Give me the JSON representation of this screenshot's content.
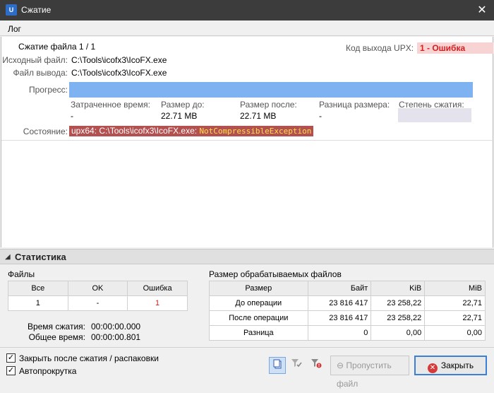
{
  "window": {
    "title": "Сжатие",
    "logo_text": "U",
    "close_glyph": "✕"
  },
  "log": {
    "tab_label": "Лог",
    "heading": "Сжатие файла 1 / 1",
    "exit_code_label": "Код выхода UPX:",
    "exit_code_value": "1 - Ошибка",
    "source_label": "Исходный файл:",
    "source_value": "C:\\Tools\\icofx3\\IcoFX.exe",
    "output_label": "Файл вывода:",
    "output_value": "C:\\Tools\\icofx3\\IcoFX.exe",
    "progress_label": "Прогресс:",
    "progress_value": 1.0,
    "elapsed_label": "Затраченное время:",
    "elapsed_value": "-",
    "size_before_label": "Размер до:",
    "size_before_value": "22.71 MB",
    "size_after_label": "Размер после:",
    "size_after_value": "22.71 MB",
    "size_diff_label": "Разница размера:",
    "size_diff_value": "-",
    "ratio_label": "Степень сжатия:",
    "state_label": "Состояние:",
    "state_prefix": "upx64: C:\\Tools\\icofx3\\IcoFX.exe:",
    "state_exception": "NotCompressibleException"
  },
  "stats": {
    "header": "Статистика",
    "files_title": "Файлы",
    "files_columns": [
      "Все",
      "OK",
      "Ошибка"
    ],
    "files_values": [
      "1",
      "-",
      "1"
    ],
    "compress_time_label": "Время сжатия:",
    "compress_time_value": "00:00:00.000",
    "total_time_label": "Общее время:",
    "total_time_value": "00:00:00.801",
    "sizes_title": "Размер обрабатываемых файлов",
    "sizes_columns": [
      "Размер",
      "Байт",
      "KiB",
      "MiB"
    ],
    "sizes_rows": [
      [
        "До операции",
        "23 816 417",
        "23 258,22",
        "22,71"
      ],
      [
        "После операции",
        "23 816 417",
        "23 258,22",
        "22,71"
      ],
      [
        "Разница",
        "0",
        "0,00",
        "0,00"
      ]
    ]
  },
  "footer": {
    "close_after_label": "Закрыть после сжатия / распаковки",
    "close_after_checked": true,
    "autoscroll_label": "Автопрокрутка",
    "autoscroll_checked": true,
    "skip_button": "Пропустить файл",
    "close_button": "Закрыть",
    "icons": [
      "copy-log-icon",
      "filter-ok-icon",
      "filter-error-icon",
      "skip-icon",
      "close-icon"
    ]
  },
  "colors": {
    "titlebar": "#3c3c3c",
    "error_red": "#d42020",
    "progress_fill": "#7fb2f0",
    "state_bg": "#b35050",
    "accent": "#3c7fd6"
  }
}
